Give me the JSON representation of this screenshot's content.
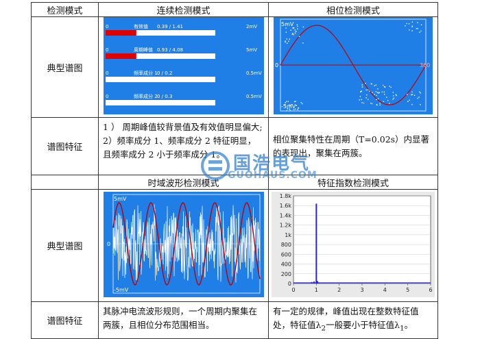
{
  "headers": {
    "mode": "检测模式",
    "continuous": "连续检测模式",
    "phase": "相位检测模式",
    "time_domain": "时域波形检测模式",
    "feature": "特征指数检测模式"
  },
  "row_labels": {
    "spectrum1": "典型谱图",
    "feature1": "谱图特征",
    "spectrum2": "典型谱图",
    "feature2": "谱图特征"
  },
  "features": {
    "continuous_l1": "1 ） 周期峰值较背景值及有效值明显偏大;",
    "continuous_l2": "2）频率成分 1、频率成分 2 特征明显，且频率成分 2 小于频率成分 1。",
    "phase": "相位聚集特性在周期（T=0.02s）内显著的表现出，聚集在两簇。",
    "time_domain": "其脉冲电流波形规则，一个周期内聚集在两簇，且相位分布范围相当。",
    "feature_index_a": "有一定的规律，峰值出现在整数特征值处，特征值λ",
    "feature_index_sub2": "2",
    "feature_index_b": "一般要小于特征值λ",
    "feature_index_sub1": "1",
    "feature_index_c": "。"
  },
  "continuous_panel": {
    "bars": [
      {
        "label": "有效值",
        "zero": "0",
        "value": "0.39 / 1.41",
        "max": "2mV",
        "red_fraction": 0.28
      },
      {
        "label": "周期峰值",
        "zero": "0",
        "value": "0.93 / 4.08",
        "max": "5mV",
        "red_fraction": 0.28
      },
      {
        "label": "频率成分 1",
        "zero": "0",
        "value": "0 / 0.2",
        "max": "0.5mV",
        "red_fraction": 0
      },
      {
        "label": "频率成分 2",
        "zero": "0",
        "value": "0 / 0.3",
        "max": "0.5mV",
        "red_fraction": 0
      }
    ]
  },
  "phase_panel": {
    "top": "5mV",
    "zero": "0",
    "bottom": "-5mV",
    "right": "360"
  },
  "time_panel": {
    "top": "5mV",
    "zero": "0",
    "bottom": "-5mV"
  },
  "watermark": {
    "title": "国浩电气",
    "sub": "GUOHAUS.COM"
  },
  "chart_data": {
    "type": "bar",
    "x": [
      0.8,
      0.9,
      1.0,
      1.05,
      1.1
    ],
    "values": [
      30,
      40,
      1640,
      50,
      20
    ],
    "xticks": [
      "0",
      "1",
      "2",
      "3",
      "4",
      "5",
      "6"
    ],
    "yticks": [
      "0",
      "200",
      "400",
      "600",
      "800",
      "1k",
      "1.2k",
      "1.4k",
      "1.6k",
      "1.8k"
    ],
    "xlim": [
      0,
      6
    ],
    "ylim": [
      0,
      1800
    ],
    "colors": {
      "bar": "#2222ee",
      "axis": "#444444",
      "grid": "#bbbbbb"
    }
  }
}
